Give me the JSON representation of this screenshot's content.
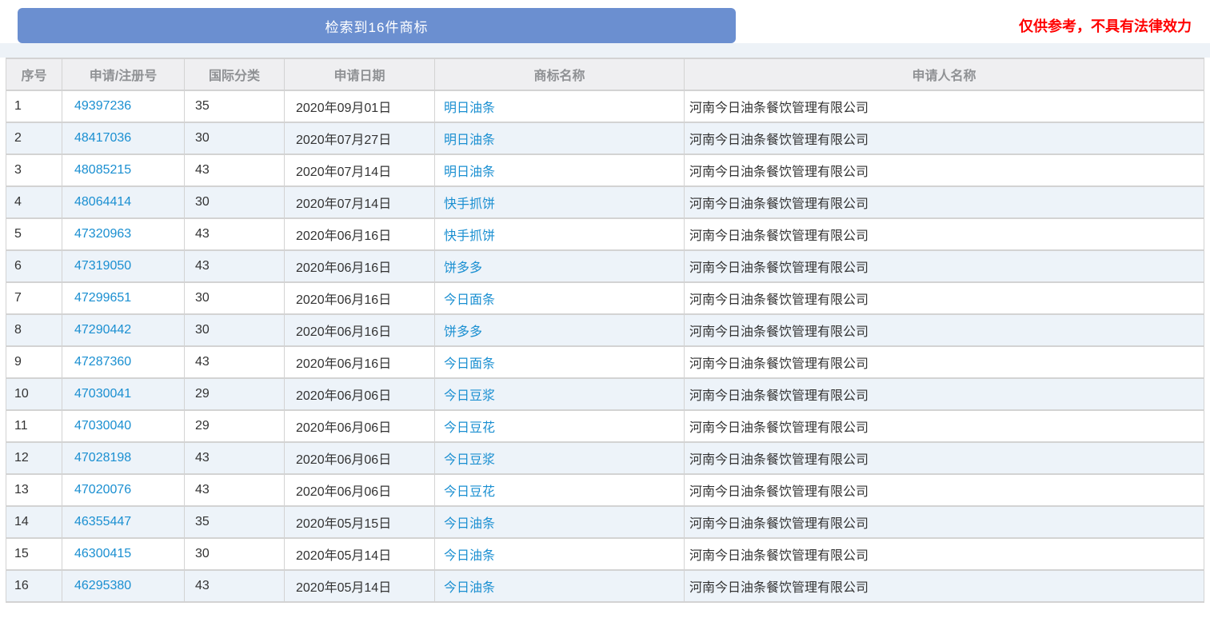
{
  "banner": {
    "label": "检索到16件商标"
  },
  "disclaimer": {
    "text": "仅供参考，不具有法律效力"
  },
  "table": {
    "headers": [
      "序号",
      "申请/注册号",
      "国际分类",
      "申请日期",
      "商标名称",
      "申请人名称"
    ],
    "rows": [
      {
        "no": "1",
        "reg_no": "49397236",
        "intl_class": "35",
        "date": "2020年09月01日",
        "name": "明日油条",
        "applicant": "河南今日油条餐饮管理有限公司"
      },
      {
        "no": "2",
        "reg_no": "48417036",
        "intl_class": "30",
        "date": "2020年07月27日",
        "name": "明日油条",
        "applicant": "河南今日油条餐饮管理有限公司"
      },
      {
        "no": "3",
        "reg_no": "48085215",
        "intl_class": "43",
        "date": "2020年07月14日",
        "name": "明日油条",
        "applicant": "河南今日油条餐饮管理有限公司"
      },
      {
        "no": "4",
        "reg_no": "48064414",
        "intl_class": "30",
        "date": "2020年07月14日",
        "name": "快手抓饼",
        "applicant": "河南今日油条餐饮管理有限公司"
      },
      {
        "no": "5",
        "reg_no": "47320963",
        "intl_class": "43",
        "date": "2020年06月16日",
        "name": "快手抓饼",
        "applicant": "河南今日油条餐饮管理有限公司"
      },
      {
        "no": "6",
        "reg_no": "47319050",
        "intl_class": "43",
        "date": "2020年06月16日",
        "name": "饼多多",
        "applicant": "河南今日油条餐饮管理有限公司"
      },
      {
        "no": "7",
        "reg_no": "47299651",
        "intl_class": "30",
        "date": "2020年06月16日",
        "name": "今日面条",
        "applicant": "河南今日油条餐饮管理有限公司"
      },
      {
        "no": "8",
        "reg_no": "47290442",
        "intl_class": "30",
        "date": "2020年06月16日",
        "name": "饼多多",
        "applicant": "河南今日油条餐饮管理有限公司"
      },
      {
        "no": "9",
        "reg_no": "47287360",
        "intl_class": "43",
        "date": "2020年06月16日",
        "name": "今日面条",
        "applicant": "河南今日油条餐饮管理有限公司"
      },
      {
        "no": "10",
        "reg_no": "47030041",
        "intl_class": "29",
        "date": "2020年06月06日",
        "name": "今日豆浆",
        "applicant": "河南今日油条餐饮管理有限公司"
      },
      {
        "no": "11",
        "reg_no": "47030040",
        "intl_class": "29",
        "date": "2020年06月06日",
        "name": "今日豆花",
        "applicant": "河南今日油条餐饮管理有限公司"
      },
      {
        "no": "12",
        "reg_no": "47028198",
        "intl_class": "43",
        "date": "2020年06月06日",
        "name": "今日豆浆",
        "applicant": "河南今日油条餐饮管理有限公司"
      },
      {
        "no": "13",
        "reg_no": "47020076",
        "intl_class": "43",
        "date": "2020年06月06日",
        "name": "今日豆花",
        "applicant": "河南今日油条餐饮管理有限公司"
      },
      {
        "no": "14",
        "reg_no": "46355447",
        "intl_class": "35",
        "date": "2020年05月15日",
        "name": "今日油条",
        "applicant": "河南今日油条餐饮管理有限公司"
      },
      {
        "no": "15",
        "reg_no": "46300415",
        "intl_class": "30",
        "date": "2020年05月14日",
        "name": "今日油条",
        "applicant": "河南今日油条餐饮管理有限公司"
      },
      {
        "no": "16",
        "reg_no": "46295380",
        "intl_class": "43",
        "date": "2020年05月14日",
        "name": "今日油条",
        "applicant": "河南今日油条餐饮管理有限公司"
      }
    ]
  },
  "colors": {
    "banner_blue": "#6b8fd0",
    "link_blue": "#1a8fd1",
    "disclaimer_red": "#ff0000",
    "stripe_blue": "#edf3f9",
    "band_gray": "#edf2f7",
    "header_bg": "#efeff1",
    "header_text": "#8f9194",
    "border_gray": "#d3d3d3",
    "text_dark": "#333333"
  }
}
